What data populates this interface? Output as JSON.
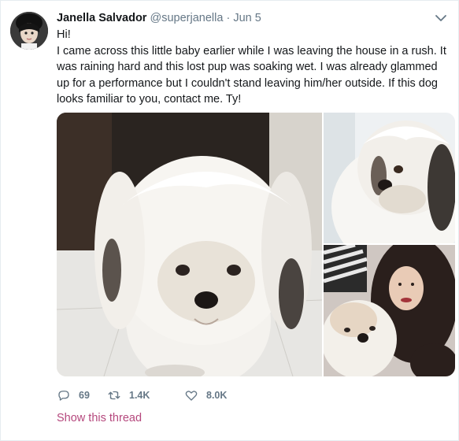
{
  "author": {
    "name": "Janella Salvador",
    "handle": "@superjanella",
    "separator": "·",
    "date": "Jun 5"
  },
  "tweet": {
    "paragraphs": [
      "Hi!",
      "I came across this little baby earlier while I was leaving the house in a rush. It was raining hard and this lost pup was soaking wet. I was already glammed up for a performance but I couldn't stand leaving him/her outside. If this dog looks familiar to you, contact me. Ty!"
    ]
  },
  "media": {
    "photos": [
      "dog-sitting-on-tile-floor",
      "dog-closeup",
      "selfie-with-dog"
    ]
  },
  "actions": {
    "replies": "69",
    "retweets": "1.4K",
    "likes": "8.0K"
  },
  "thread_link": "Show this thread",
  "colors": {
    "link_accent": "#b5487d",
    "muted_text": "#657786"
  },
  "icons": {
    "menu": "chevron-down-icon",
    "reply": "reply-icon",
    "retweet": "retweet-icon",
    "like": "heart-icon"
  }
}
